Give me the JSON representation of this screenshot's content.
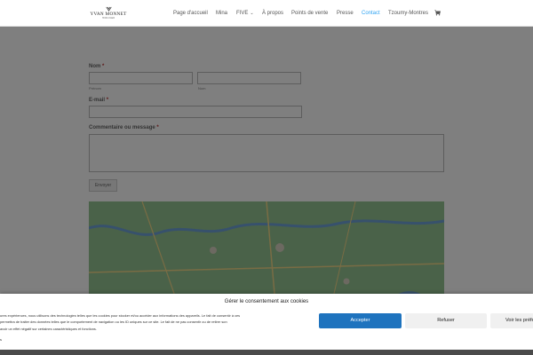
{
  "header": {
    "logo": {
      "name": "YVAN MONNET",
      "tagline": "HORLOGER"
    },
    "nav": [
      {
        "label": "Page d'accueil"
      },
      {
        "label": "Mina"
      },
      {
        "label": "FIVE",
        "chevron": "chevron-down-icon"
      },
      {
        "label": "À propos"
      },
      {
        "label": "Points de vente"
      },
      {
        "label": "Presse"
      },
      {
        "label": "Contact",
        "active": true
      },
      {
        "label": "Tzoumy-Montres"
      }
    ],
    "cart_icon": "cart-icon"
  },
  "form": {
    "name_label": "Nom",
    "required_mark": "*",
    "first_name_sublabel": "Prénom",
    "last_name_sublabel": "Nom",
    "email_label": "E-mail",
    "comment_label": "Commentaire ou message",
    "submit_label": "Envoyer"
  },
  "map": {
    "kind": "embedded-map",
    "colors": {
      "land": "#94c493",
      "water": "#6fa3d9",
      "roads": "#f3d889"
    }
  },
  "cookie_banner": {
    "title": "Gérer le consentement aux cookies",
    "text_lines": [
      "ures expériences, nous utilisons des technologies telles que les cookies pour stocker et/ou accéder aux informations des appareils. Le fait de consentir à ces",
      "permettra de traiter des données telles que le comportement de navigation ou les ID uniques sur ce site. Le fait de ne pas consentir ou de retirer son",
      "avoir un effet négatif sur certaines caractéristiques et fonctions."
    ],
    "accept_label": "Accepter",
    "refuse_label": "Refuser",
    "prefs_label": "Voir les préférences",
    "bottom_link": "s",
    "colors": {
      "accept_bg": "#1e73be",
      "secondary_bg": "#f0f0f0",
      "overlay": "rgba(0,0,0,0.5)"
    }
  }
}
